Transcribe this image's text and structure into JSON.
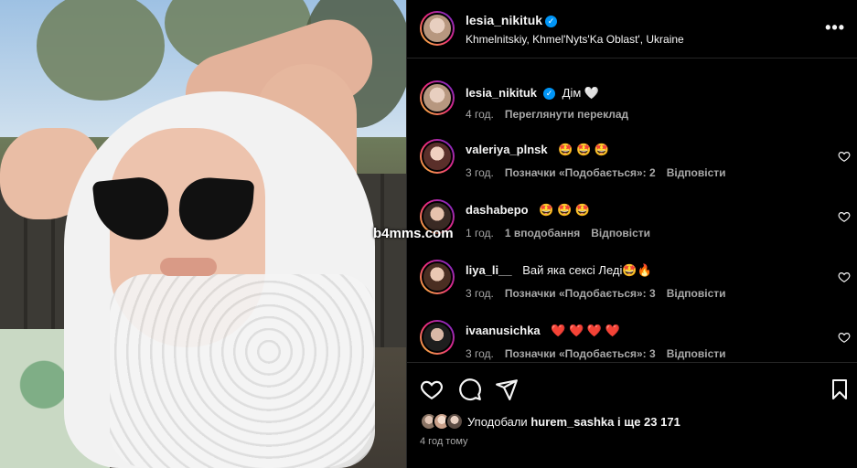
{
  "post": {
    "watermark": "b4mms.com"
  },
  "header": {
    "username": "lesia_nikituk",
    "verified_mark": "✓",
    "location": "Khmelnitskiy, Khmel'Nyts'Ka Oblast', Ukraine",
    "more_label": "•••"
  },
  "caption": {
    "username": "lesia_nikituk",
    "verified_mark": "✓",
    "text": "Дім 🤍",
    "time": "4 год.",
    "translate_label": "Переглянути переклад"
  },
  "comments": [
    {
      "username": "valeriya_plnsk",
      "text": "🤩 🤩 🤩",
      "time": "3 год.",
      "likes_label": "Позначки «Подобається»: 2",
      "reply_label": "Відповісти"
    },
    {
      "username": "dashabepo",
      "text": "🤩 🤩 🤩",
      "time": "1 год.",
      "likes_label": "1 вподобання",
      "reply_label": "Відповісти"
    },
    {
      "username": "liya_li__",
      "text": "Вай яка сексі Леді🤩🔥",
      "time": "3 год.",
      "likes_label": "Позначки «Подобається»: 3",
      "reply_label": "Відповісти"
    },
    {
      "username": "ivaanusichka",
      "text": "❤️ ❤️ ❤️ ❤️",
      "time": "3 год.",
      "likes_label": "Позначки «Подобається»: 3",
      "reply_label": "Відповісти"
    }
  ],
  "likes": {
    "prefix": "Уподобали",
    "user": "hurem_sashka",
    "suffix": "і ще 23 171"
  },
  "posted_ago": "4 год тому",
  "colors": {
    "background": "#000000",
    "text": "#f5f5f5",
    "secondary_text": "#a8a8a8",
    "verified": "#0095f6",
    "divider": "#262626"
  }
}
